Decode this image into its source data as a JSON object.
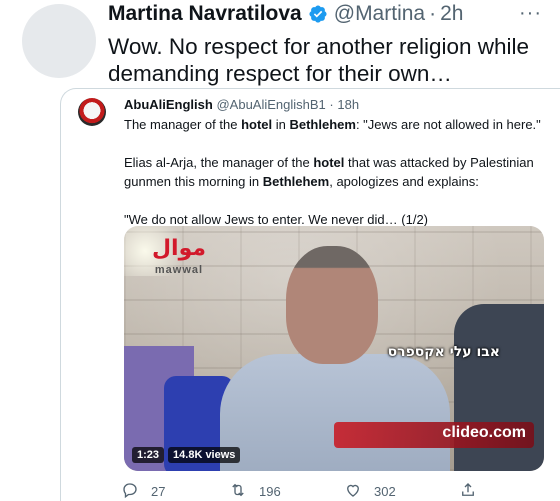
{
  "tweet": {
    "author_name": "Martina Navratilova",
    "handle": "@Martina",
    "separator": "·",
    "time": "2h",
    "more_label": "···",
    "text": "Wow. No respect for another religion while demanding respect for their own…"
  },
  "quote": {
    "author_name": "AbuAliEnglish",
    "handle": "@AbuAliEnglishB1",
    "separator": "·",
    "time": "18h",
    "para1_a": "The manager of the ",
    "para1_b": "hotel",
    "para1_c": " in ",
    "para1_d": "Bethlehem",
    "para1_e": ": \"Jews are not allowed in here.\"",
    "para2_a": "Elias al-Arja, the manager of the ",
    "para2_b": "hotel",
    "para2_c": " that was attacked by Palestinian gunmen this morning in ",
    "para2_d": "Bethlehem",
    "para2_e": ", apologizes and explains:",
    "para3": "\"We do not allow Jews to enter. We never did… (1/2)"
  },
  "video": {
    "logo_text": "موال",
    "logo_word": "mawwal",
    "caption": "אבו עלי אקספרס",
    "lower_third_logo": "clideo.com",
    "duration": "1:23",
    "views": "14.8K views"
  },
  "actions": {
    "replies": "27",
    "retweets": "196",
    "likes": "302"
  },
  "colors": {
    "verified": "#1d9bf0",
    "muted": "#536471",
    "border": "#cfd9de"
  }
}
